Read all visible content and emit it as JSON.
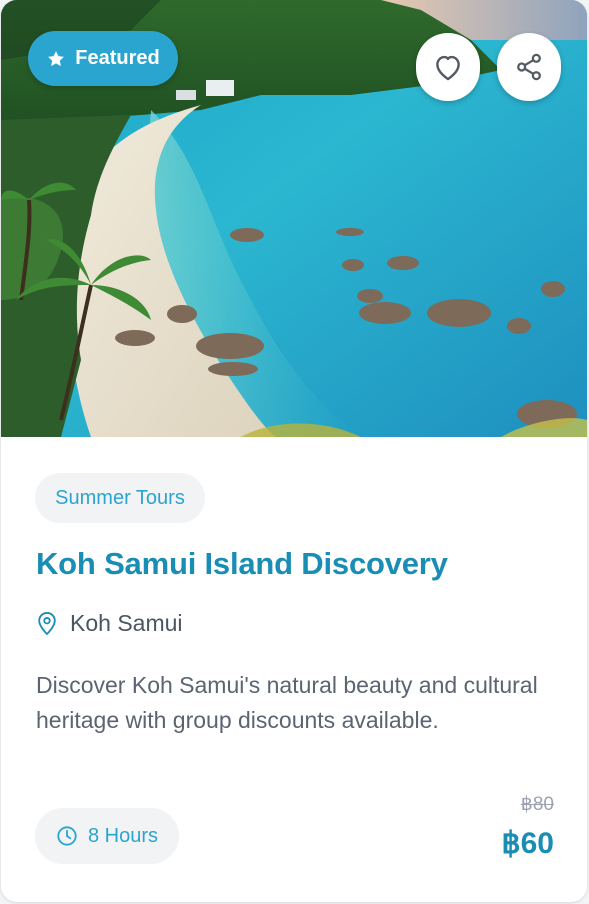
{
  "card": {
    "badge_label": "Featured",
    "category": "Summer Tours",
    "title": "Koh Samui Island Discovery",
    "location": "Koh Samui",
    "description": "Discover Koh Samui's natural beauty and cultural heritage with group discounts available.",
    "duration": "8 Hours",
    "original_price": "฿80",
    "price": "฿60"
  },
  "colors": {
    "accent": "#2aa5cf",
    "title": "#1a8db4",
    "chip_bg": "#f1f3f5",
    "muted": "#9ca3af"
  },
  "icons": [
    "star-icon",
    "heart-icon",
    "share-icon",
    "map-pin-icon",
    "clock-icon"
  ]
}
